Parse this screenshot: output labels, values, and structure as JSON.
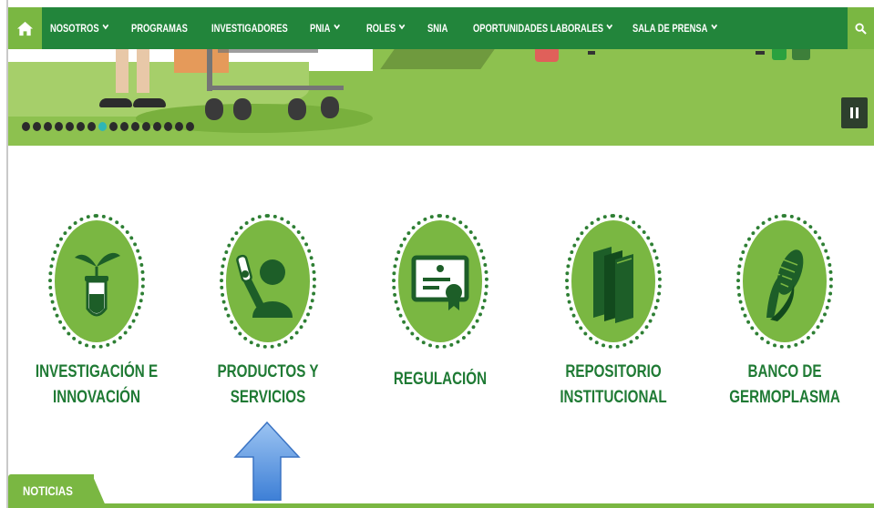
{
  "nav": {
    "home_icon": "home-icon",
    "search_icon": "search-icon",
    "items": [
      {
        "label": "NOSOTROS",
        "dropdown": true
      },
      {
        "label": "PROGRAMAS",
        "dropdown": false
      },
      {
        "label": "INVESTIGADORES",
        "dropdown": false
      },
      {
        "label": "PNIA",
        "dropdown": true
      },
      {
        "label": "ROLES",
        "dropdown": true
      },
      {
        "label": "SNIA",
        "dropdown": false
      },
      {
        "label": "OPORTUNIDADES LABORALES",
        "dropdown": true
      },
      {
        "label": "SALA DE PRENSA",
        "dropdown": true
      }
    ]
  },
  "slider": {
    "dot_count": 16,
    "active_dot": 7,
    "pause_icon": "pause-icon"
  },
  "services": [
    {
      "line1": "INVESTIGACIÓN E",
      "line2": "INNOVACIÓN",
      "icon": "test-tube-plant-icon"
    },
    {
      "line1": "PRODUCTOS Y",
      "line2": "SERVICIOS",
      "icon": "scientist-icon"
    },
    {
      "line1": "REGULACIÓN",
      "line2": "",
      "icon": "certificate-icon"
    },
    {
      "line1": "REPOSITORIO",
      "line2": "INSTITUCIONAL",
      "icon": "books-icon"
    },
    {
      "line1": "BANCO DE",
      "line2": "GERMOPLASMA",
      "icon": "corn-icon"
    }
  ],
  "news": {
    "label": "NOTICIAS"
  },
  "colors": {
    "nav_bg": "#22853b",
    "accent_green": "#7ab742",
    "label_green": "#1f7a34",
    "arrow_blue": "#4a8be0"
  }
}
